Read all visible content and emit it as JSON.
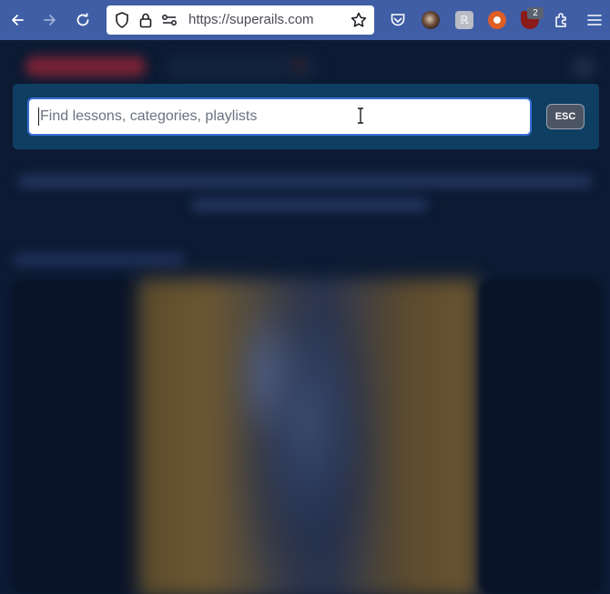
{
  "browser": {
    "url": "https://superails.com",
    "extension_badge_count": "2",
    "icons": [
      "back-icon",
      "forward-icon",
      "reload-icon",
      "shield-icon",
      "lock-icon",
      "permissions-icon",
      "bookmark-star-icon",
      "pocket-icon",
      "extensions-icon",
      "menu-icon"
    ]
  },
  "search": {
    "placeholder": "Find lessons, categories, playlists",
    "value": "",
    "esc_label": "ESC"
  },
  "colors": {
    "toolbar": "#3f5ea6",
    "search_panel": "#0e3f63",
    "input_border": "#3b6fd6",
    "page_background": "#0c1a33"
  }
}
